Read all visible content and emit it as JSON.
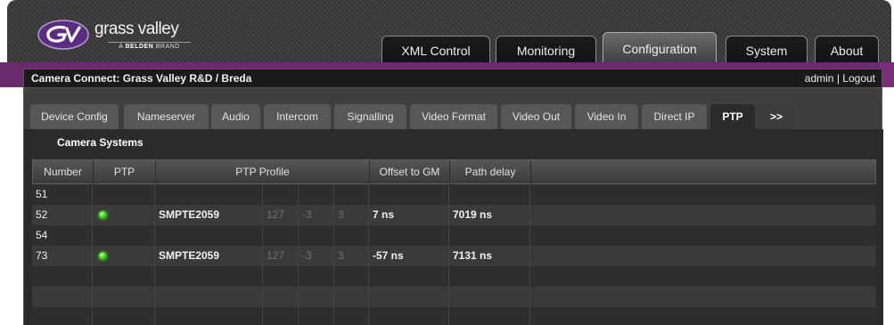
{
  "logo": {
    "wordmark": "grass valley",
    "tagline_prefix": "A",
    "tagline_brand": "BELDEN",
    "tagline_suffix": "BRAND"
  },
  "main_tabs": [
    {
      "label": "XML Control",
      "active": false
    },
    {
      "label": "Monitoring",
      "active": false
    },
    {
      "label": "Configuration",
      "active": true
    },
    {
      "label": "System",
      "active": false
    },
    {
      "label": "About",
      "active": false
    }
  ],
  "title_bar": {
    "title": "Camera Connect: Grass Valley R&D / Breda",
    "user": "admin",
    "separator": "|",
    "logout": "Logout"
  },
  "sub_tabs": [
    {
      "label": "Device Config",
      "active": false
    },
    {
      "label": "Nameserver",
      "active": false
    },
    {
      "label": "Audio",
      "active": false
    },
    {
      "label": "Intercom",
      "active": false
    },
    {
      "label": "Signalling",
      "active": false
    },
    {
      "label": "Video Format",
      "active": false
    },
    {
      "label": "Video Out",
      "active": false
    },
    {
      "label": "Video In",
      "active": false
    },
    {
      "label": "Direct IP",
      "active": false
    },
    {
      "label": "PTP",
      "active": true
    },
    {
      "label": ">>",
      "active": false
    }
  ],
  "section": {
    "title": "Camera Systems",
    "columns": [
      "Number",
      "PTP",
      "PTP Profile",
      "Offset to GM",
      "Path delay"
    ],
    "rows": [
      {
        "number": "51",
        "ptp_ok": false,
        "profile": "",
        "p1": "",
        "p2": "",
        "p3": "",
        "offset": "",
        "path_delay": ""
      },
      {
        "number": "52",
        "ptp_ok": true,
        "profile": "SMPTE2059",
        "p1": "127",
        "p2": "-3",
        "p3": "3",
        "offset": "7 ns",
        "path_delay": "7019 ns"
      },
      {
        "number": "54",
        "ptp_ok": false,
        "profile": "",
        "p1": "",
        "p2": "",
        "p3": "",
        "offset": "",
        "path_delay": ""
      },
      {
        "number": "73",
        "ptp_ok": true,
        "profile": "SMPTE2059",
        "p1": "127",
        "p2": "-3",
        "p3": "3",
        "offset": "-57 ns",
        "path_delay": "7131 ns"
      },
      {
        "number": "",
        "ptp_ok": false,
        "profile": "",
        "p1": "",
        "p2": "",
        "p3": "",
        "offset": "",
        "path_delay": ""
      },
      {
        "number": "",
        "ptp_ok": false,
        "profile": "",
        "p1": "",
        "p2": "",
        "p3": "",
        "offset": "",
        "path_delay": ""
      },
      {
        "number": "",
        "ptp_ok": false,
        "profile": "",
        "p1": "",
        "p2": "",
        "p3": "",
        "offset": "",
        "path_delay": ""
      }
    ]
  },
  "colors": {
    "brand_purple": "#6b2a6b",
    "ptp_locked_led": "#3fd41c"
  }
}
